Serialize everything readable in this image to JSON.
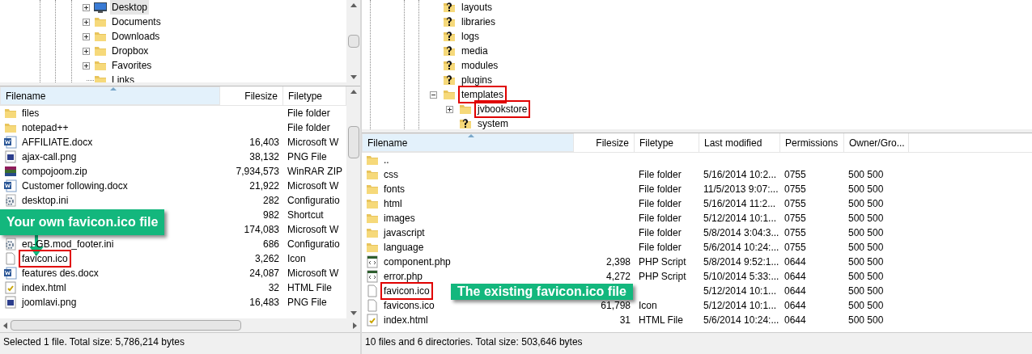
{
  "local_tree": {
    "items": [
      {
        "label": "Desktop",
        "kind": "monitor",
        "expanded": false,
        "selected": true
      },
      {
        "label": "Documents",
        "kind": "folder",
        "expanded": false,
        "selected": false
      },
      {
        "label": "Downloads",
        "kind": "folder",
        "expanded": false,
        "selected": false
      },
      {
        "label": "Dropbox",
        "kind": "folder",
        "expanded": false,
        "selected": false
      },
      {
        "label": "Favorites",
        "kind": "folder",
        "expanded": false,
        "selected": false
      },
      {
        "label": "Links",
        "kind": "folder",
        "selected": false
      }
    ]
  },
  "local_list": {
    "columns": [
      {
        "label": "Filename",
        "sorted": true
      },
      {
        "label": "Filesize",
        "sorted": false
      },
      {
        "label": "Filetype",
        "sorted": false
      }
    ],
    "rows": [
      {
        "kind": "folder",
        "name": "files",
        "type": "File folder",
        "marked": false
      },
      {
        "kind": "folder",
        "name": "notepad++",
        "type": "File folder",
        "marked": false
      },
      {
        "kind": "word",
        "name": "AFFILIATE.docx",
        "size": "16,403",
        "type": "Microsoft W",
        "marked": false
      },
      {
        "kind": "image",
        "name": "ajax-call.png",
        "size": "38,132",
        "type": "PNG File",
        "marked": false
      },
      {
        "kind": "archive",
        "name": "compojoom.zip",
        "size": "7,934,573",
        "type": "WinRAR ZIP",
        "marked": false
      },
      {
        "kind": "word",
        "name": "Customer following.docx",
        "size": "21,922",
        "type": "Microsoft W",
        "marked": false
      },
      {
        "kind": "config",
        "name": "desktop.ini",
        "size": "282",
        "type": "Configuratio",
        "marked": false
      },
      {
        "size": "982",
        "type": "Shortcut"
      },
      {
        "size": "174,083",
        "type": "Microsoft W"
      },
      {
        "kind": "config",
        "name": "en-GB.mod_footer.ini",
        "size": "686",
        "type": "Configuratio",
        "marked": false
      },
      {
        "kind": "blank",
        "name": "favicon.ico",
        "size": "3,262",
        "type": "Icon",
        "marked": true
      },
      {
        "kind": "word",
        "name": "features des.docx",
        "size": "24,087",
        "type": "Microsoft W",
        "marked": false
      },
      {
        "kind": "html",
        "name": "index.html",
        "size": "32",
        "type": "HTML File",
        "marked": false
      },
      {
        "kind": "image",
        "name": "joomlavi.png",
        "size": "16,483",
        "type": "PNG File",
        "marked": false
      }
    ],
    "callout": {
      "text": "Your own favicon.ico file",
      "pointer": true
    }
  },
  "local_status": "Selected 1 file. Total size: 5,786,214 bytes",
  "remote_tree": {
    "items": [
      {
        "label": "layouts",
        "kind": "unknown",
        "marked": false
      },
      {
        "label": "libraries",
        "kind": "unknown",
        "marked": false
      },
      {
        "label": "logs",
        "kind": "unknown",
        "marked": false
      },
      {
        "label": "media",
        "kind": "unknown",
        "marked": false
      },
      {
        "label": "modules",
        "kind": "unknown",
        "marked": false
      },
      {
        "label": "plugins",
        "kind": "unknown",
        "marked": false
      },
      {
        "label": "templates",
        "kind": "folder",
        "expanded": true,
        "marked": true,
        "children": [
          {
            "label": "jvbookstore",
            "kind": "folder",
            "expanded": false,
            "marked": true
          },
          {
            "label": "system",
            "kind": "unknown",
            "marked": false
          }
        ]
      }
    ]
  },
  "remote_list": {
    "columns": [
      {
        "label": "Filename",
        "sorted": true
      },
      {
        "label": "Filesize",
        "sorted": false
      },
      {
        "label": "Filetype",
        "sorted": false
      },
      {
        "label": "Last modified",
        "sorted": false
      },
      {
        "label": "Permissions",
        "sorted": false
      },
      {
        "label": "Owner/Gro...",
        "sorted": false
      }
    ],
    "rows": [
      {
        "kind": "folder",
        "name": "..",
        "marked": false
      },
      {
        "kind": "folder",
        "name": "css",
        "type": "File folder",
        "modified": "5/16/2014 10:2...",
        "permissions": "0755",
        "owner": "500 500",
        "marked": false
      },
      {
        "kind": "folder",
        "name": "fonts",
        "type": "File folder",
        "modified": "11/5/2013 9:07:...",
        "permissions": "0755",
        "owner": "500 500",
        "marked": false
      },
      {
        "kind": "folder",
        "name": "html",
        "type": "File folder",
        "modified": "5/16/2014 11:2...",
        "permissions": "0755",
        "owner": "500 500",
        "marked": false
      },
      {
        "kind": "folder",
        "name": "images",
        "type": "File folder",
        "modified": "5/12/2014 10:1...",
        "permissions": "0755",
        "owner": "500 500",
        "marked": false
      },
      {
        "kind": "folder",
        "name": "javascript",
        "type": "File folder",
        "modified": "5/8/2014 3:04:3...",
        "permissions": "0755",
        "owner": "500 500",
        "marked": false
      },
      {
        "kind": "folder",
        "name": "language",
        "type": "File folder",
        "modified": "5/6/2014 10:24:...",
        "permissions": "0755",
        "owner": "500 500",
        "marked": false
      },
      {
        "kind": "php",
        "name": "component.php",
        "size": "2,398",
        "type": "PHP Script",
        "modified": "5/8/2014 9:52:1...",
        "permissions": "0644",
        "owner": "500 500",
        "marked": false
      },
      {
        "kind": "php",
        "name": "error.php",
        "size": "4,272",
        "type": "PHP Script",
        "modified": "5/10/2014 5:33:...",
        "permissions": "0644",
        "owner": "500 500",
        "marked": false
      },
      {
        "kind": "blank",
        "name": "favicon.ico",
        "modified": "5/12/2014 10:1...",
        "permissions": "0644",
        "owner": "500 500",
        "marked": true
      },
      {
        "kind": "blank",
        "name": "favicons.ico",
        "size": "61,798",
        "type": "Icon",
        "modified": "5/12/2014 10:1...",
        "permissions": "0644",
        "owner": "500 500",
        "marked": false
      },
      {
        "kind": "html",
        "name": "index.html",
        "size": "31",
        "type": "HTML File",
        "modified": "5/6/2014 10:24:...",
        "permissions": "0644",
        "owner": "500 500",
        "marked": false
      }
    ],
    "callout": {
      "text": "The existing favicon.ico file"
    }
  },
  "remote_status": "10 files and 6 directories. Total size: 503,646 bytes"
}
